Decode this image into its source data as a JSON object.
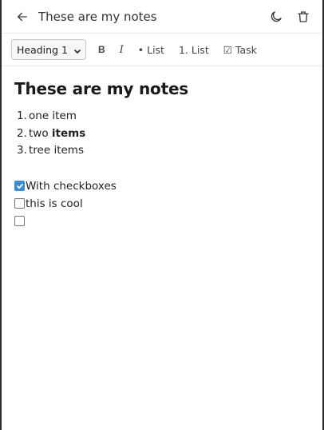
{
  "header": {
    "back_icon": "arrow-left-icon",
    "title": "These are my notes",
    "theme_icon": "moon-icon",
    "delete_icon": "trash-icon"
  },
  "toolbar": {
    "block_type_selected": "Heading 1",
    "bold_label": "B",
    "italic_label": "I",
    "bullet_list_label": "• List",
    "ordered_list_label": "1. List",
    "task_label": "☑ Task"
  },
  "editor": {
    "heading": "These are my notes",
    "ordered_list": [
      {
        "number": "1.",
        "text": "one item",
        "bold": ""
      },
      {
        "number": "2.",
        "text": "two ",
        "bold": "items"
      },
      {
        "number": "3.",
        "text": "tree items",
        "bold": ""
      }
    ],
    "tasks": [
      {
        "text": "With checkboxes",
        "checked": true
      },
      {
        "text": "this is cool",
        "checked": false
      },
      {
        "text": "",
        "checked": false
      }
    ]
  },
  "colors": {
    "accent": "#3b8bd6",
    "border": "#ececec",
    "window_frame": "#2b2b2b"
  }
}
